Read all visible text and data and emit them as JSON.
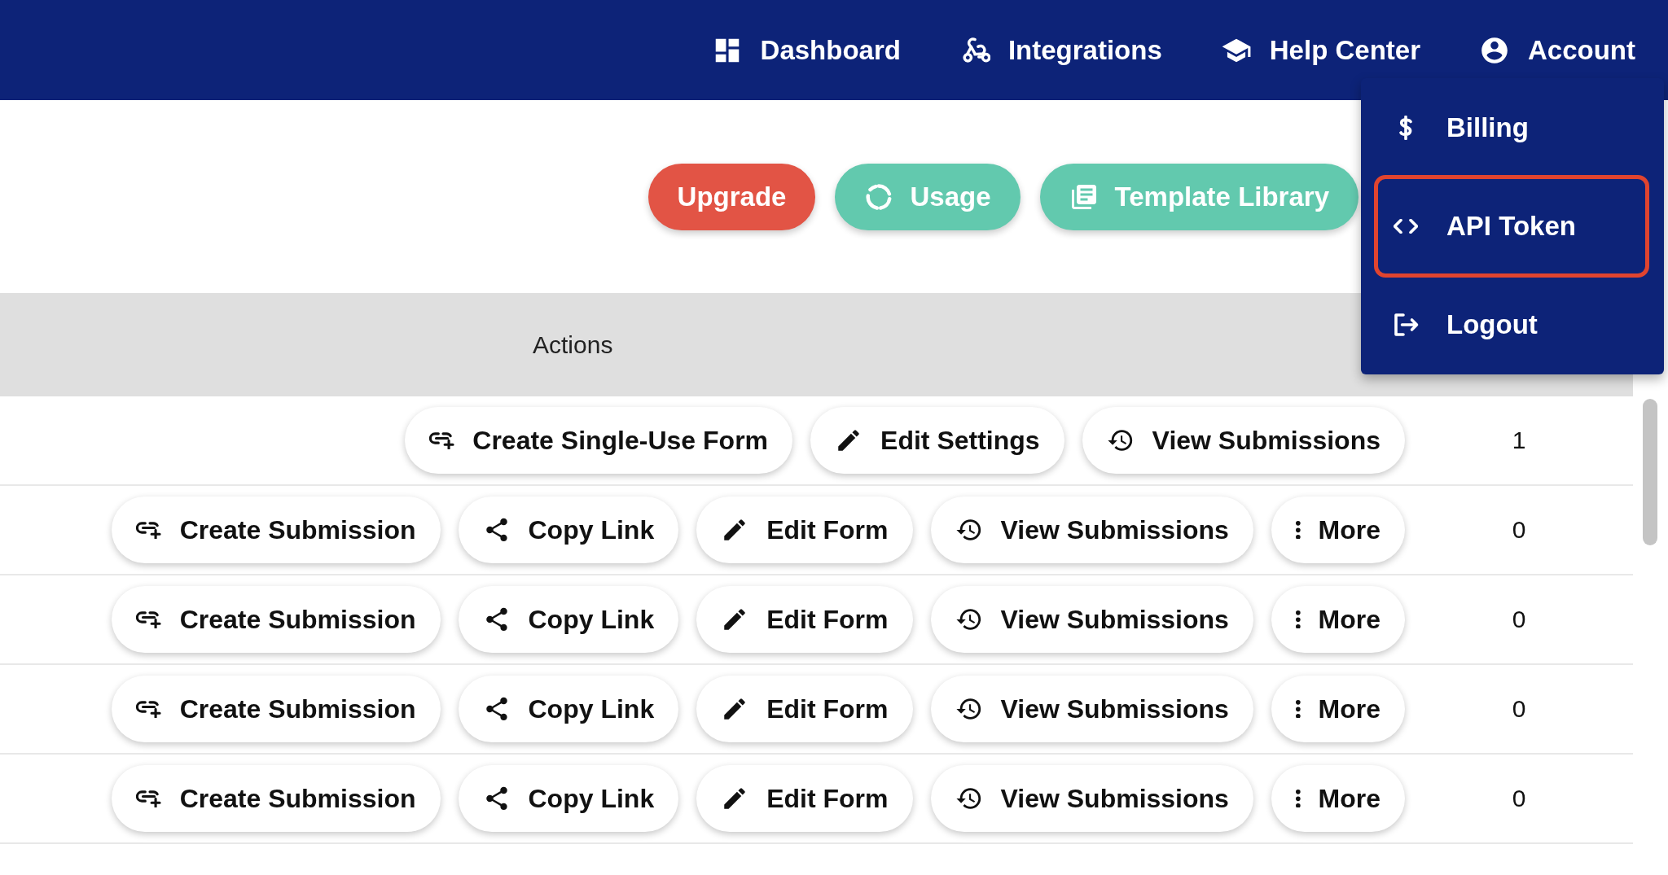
{
  "nav": [
    {
      "label": "Dashboard",
      "kind": "dashboard"
    },
    {
      "label": "Integrations",
      "kind": "integrations"
    },
    {
      "label": "Help Center",
      "kind": "help"
    },
    {
      "label": "Account",
      "kind": "account"
    }
  ],
  "account_menu": {
    "items": [
      {
        "label": "Billing",
        "kind": "billing",
        "highlighted": false
      },
      {
        "label": "API Token",
        "kind": "token",
        "highlighted": true
      },
      {
        "label": "Logout",
        "kind": "logout",
        "highlighted": false
      }
    ]
  },
  "toolbar": [
    {
      "label": "Upgrade",
      "kind": "upgrade"
    },
    {
      "label": "Usage",
      "kind": "usage"
    },
    {
      "label": "Template Library",
      "kind": "library"
    }
  ],
  "table": {
    "columns": [
      "Actions"
    ],
    "rows": [
      {
        "actions": [
          {
            "label": "Create Single-Use Form",
            "kind": "create"
          },
          {
            "label": "Edit Settings",
            "kind": "edit"
          },
          {
            "label": "View Submissions",
            "kind": "submissions"
          }
        ],
        "count": "1"
      },
      {
        "actions": [
          {
            "label": "Create Submission",
            "kind": "create"
          },
          {
            "label": "Copy Link",
            "kind": "copy"
          },
          {
            "label": "Edit Form",
            "kind": "edit"
          },
          {
            "label": "View Submissions",
            "kind": "submissions"
          },
          {
            "label": "More",
            "kind": "more"
          }
        ],
        "count": "0"
      },
      {
        "actions": [
          {
            "label": "Create Submission",
            "kind": "create"
          },
          {
            "label": "Copy Link",
            "kind": "copy"
          },
          {
            "label": "Edit Form",
            "kind": "edit"
          },
          {
            "label": "View Submissions",
            "kind": "submissions"
          },
          {
            "label": "More",
            "kind": "more"
          }
        ],
        "count": "0"
      },
      {
        "actions": [
          {
            "label": "Create Submission",
            "kind": "create"
          },
          {
            "label": "Copy Link",
            "kind": "copy"
          },
          {
            "label": "Edit Form",
            "kind": "edit"
          },
          {
            "label": "View Submissions",
            "kind": "submissions"
          },
          {
            "label": "More",
            "kind": "more"
          }
        ],
        "count": "0"
      },
      {
        "actions": [
          {
            "label": "Create Submission",
            "kind": "create"
          },
          {
            "label": "Copy Link",
            "kind": "copy"
          },
          {
            "label": "Edit Form",
            "kind": "edit"
          },
          {
            "label": "View Submissions",
            "kind": "submissions"
          },
          {
            "label": "More",
            "kind": "more"
          }
        ],
        "count": "0"
      }
    ]
  }
}
